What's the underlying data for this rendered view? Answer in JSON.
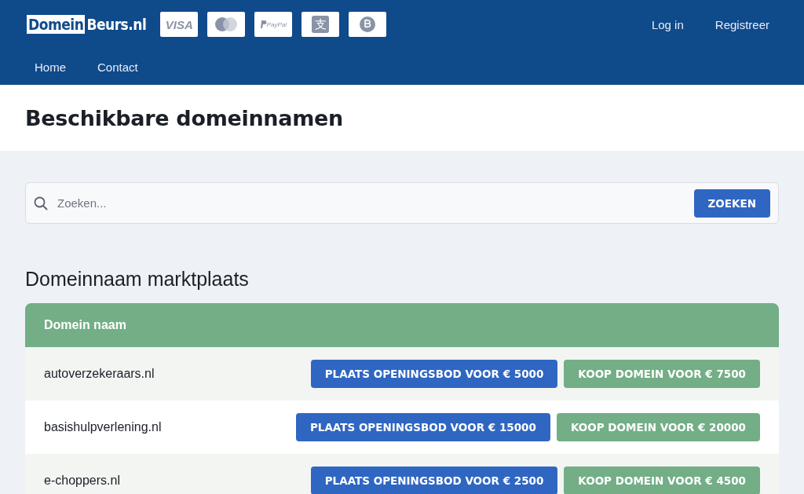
{
  "header": {
    "logo": {
      "part_1": "Domein",
      "part_2": "Beurs.nl"
    },
    "payment_icons": [
      {
        "kind": "visa",
        "text": "VISA"
      },
      {
        "kind": "mastercard"
      },
      {
        "kind": "paypal",
        "text": "PayPal"
      },
      {
        "kind": "alipay",
        "text": "支"
      },
      {
        "kind": "bitcoin"
      }
    ],
    "auth_links": [
      "Log in",
      "Registreer"
    ],
    "nav": [
      "Home",
      "Contact"
    ]
  },
  "page_title": "Beschikbare domeinnamen",
  "search": {
    "placeholder": "Zoeken...",
    "button": "ZOEKEN"
  },
  "section_title": "Domeinnaam marktplaats",
  "table": {
    "columns": [
      "Domein naam"
    ],
    "rows": [
      {
        "domain": "autoverzekeraars.nl",
        "bid_button": "PLAATS OPENINGSBOD VOOR € 5000",
        "buy_button": "KOOP DOMEIN VOOR € 7500"
      },
      {
        "domain": "basishulpverlening.nl",
        "bid_button": "PLAATS OPENINGSBOD VOOR € 15000",
        "buy_button": "KOOP DOMEIN VOOR € 20000"
      },
      {
        "domain": "e-choppers.nl",
        "bid_button": "PLAATS OPENINGSBOD VOOR € 2500",
        "buy_button": "KOOP DOMEIN VOOR € 4500"
      }
    ]
  }
}
